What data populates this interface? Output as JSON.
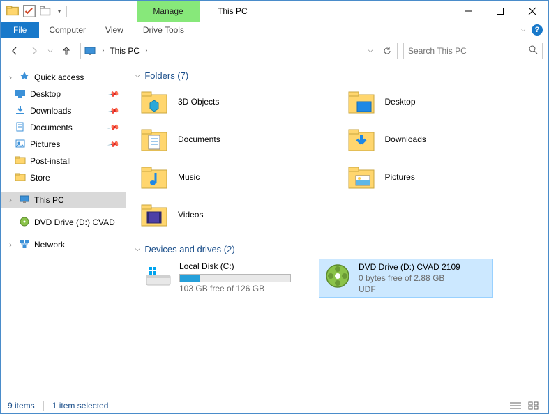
{
  "window": {
    "contextual_tab": "Manage",
    "title": "This PC"
  },
  "ribbon": {
    "file": "File",
    "computer": "Computer",
    "view": "View",
    "drive_tools": "Drive Tools"
  },
  "nav": {
    "address_location": "This PC",
    "search_placeholder": "Search This PC"
  },
  "sidebar": {
    "quick_access": "Quick access",
    "desktop": "Desktop",
    "downloads": "Downloads",
    "documents": "Documents",
    "pictures": "Pictures",
    "post_install": "Post-install",
    "store": "Store",
    "this_pc": "This PC",
    "dvd": "DVD Drive (D:) CVAD",
    "network": "Network"
  },
  "groups": {
    "folders_label": "Folders (7)",
    "drives_label": "Devices and drives (2)"
  },
  "folders": {
    "objects3d": "3D Objects",
    "desktop": "Desktop",
    "documents": "Documents",
    "downloads": "Downloads",
    "music": "Music",
    "pictures": "Pictures",
    "videos": "Videos"
  },
  "drives": {
    "local": {
      "title": "Local Disk (C:)",
      "sub": "103 GB free of 126 GB",
      "used_pct": 18
    },
    "dvd": {
      "title": "DVD Drive (D:) CVAD 2109",
      "sub": "0 bytes free of 2.88 GB",
      "fs": "UDF"
    }
  },
  "status": {
    "items": "9 items",
    "selected": "1 item selected"
  }
}
